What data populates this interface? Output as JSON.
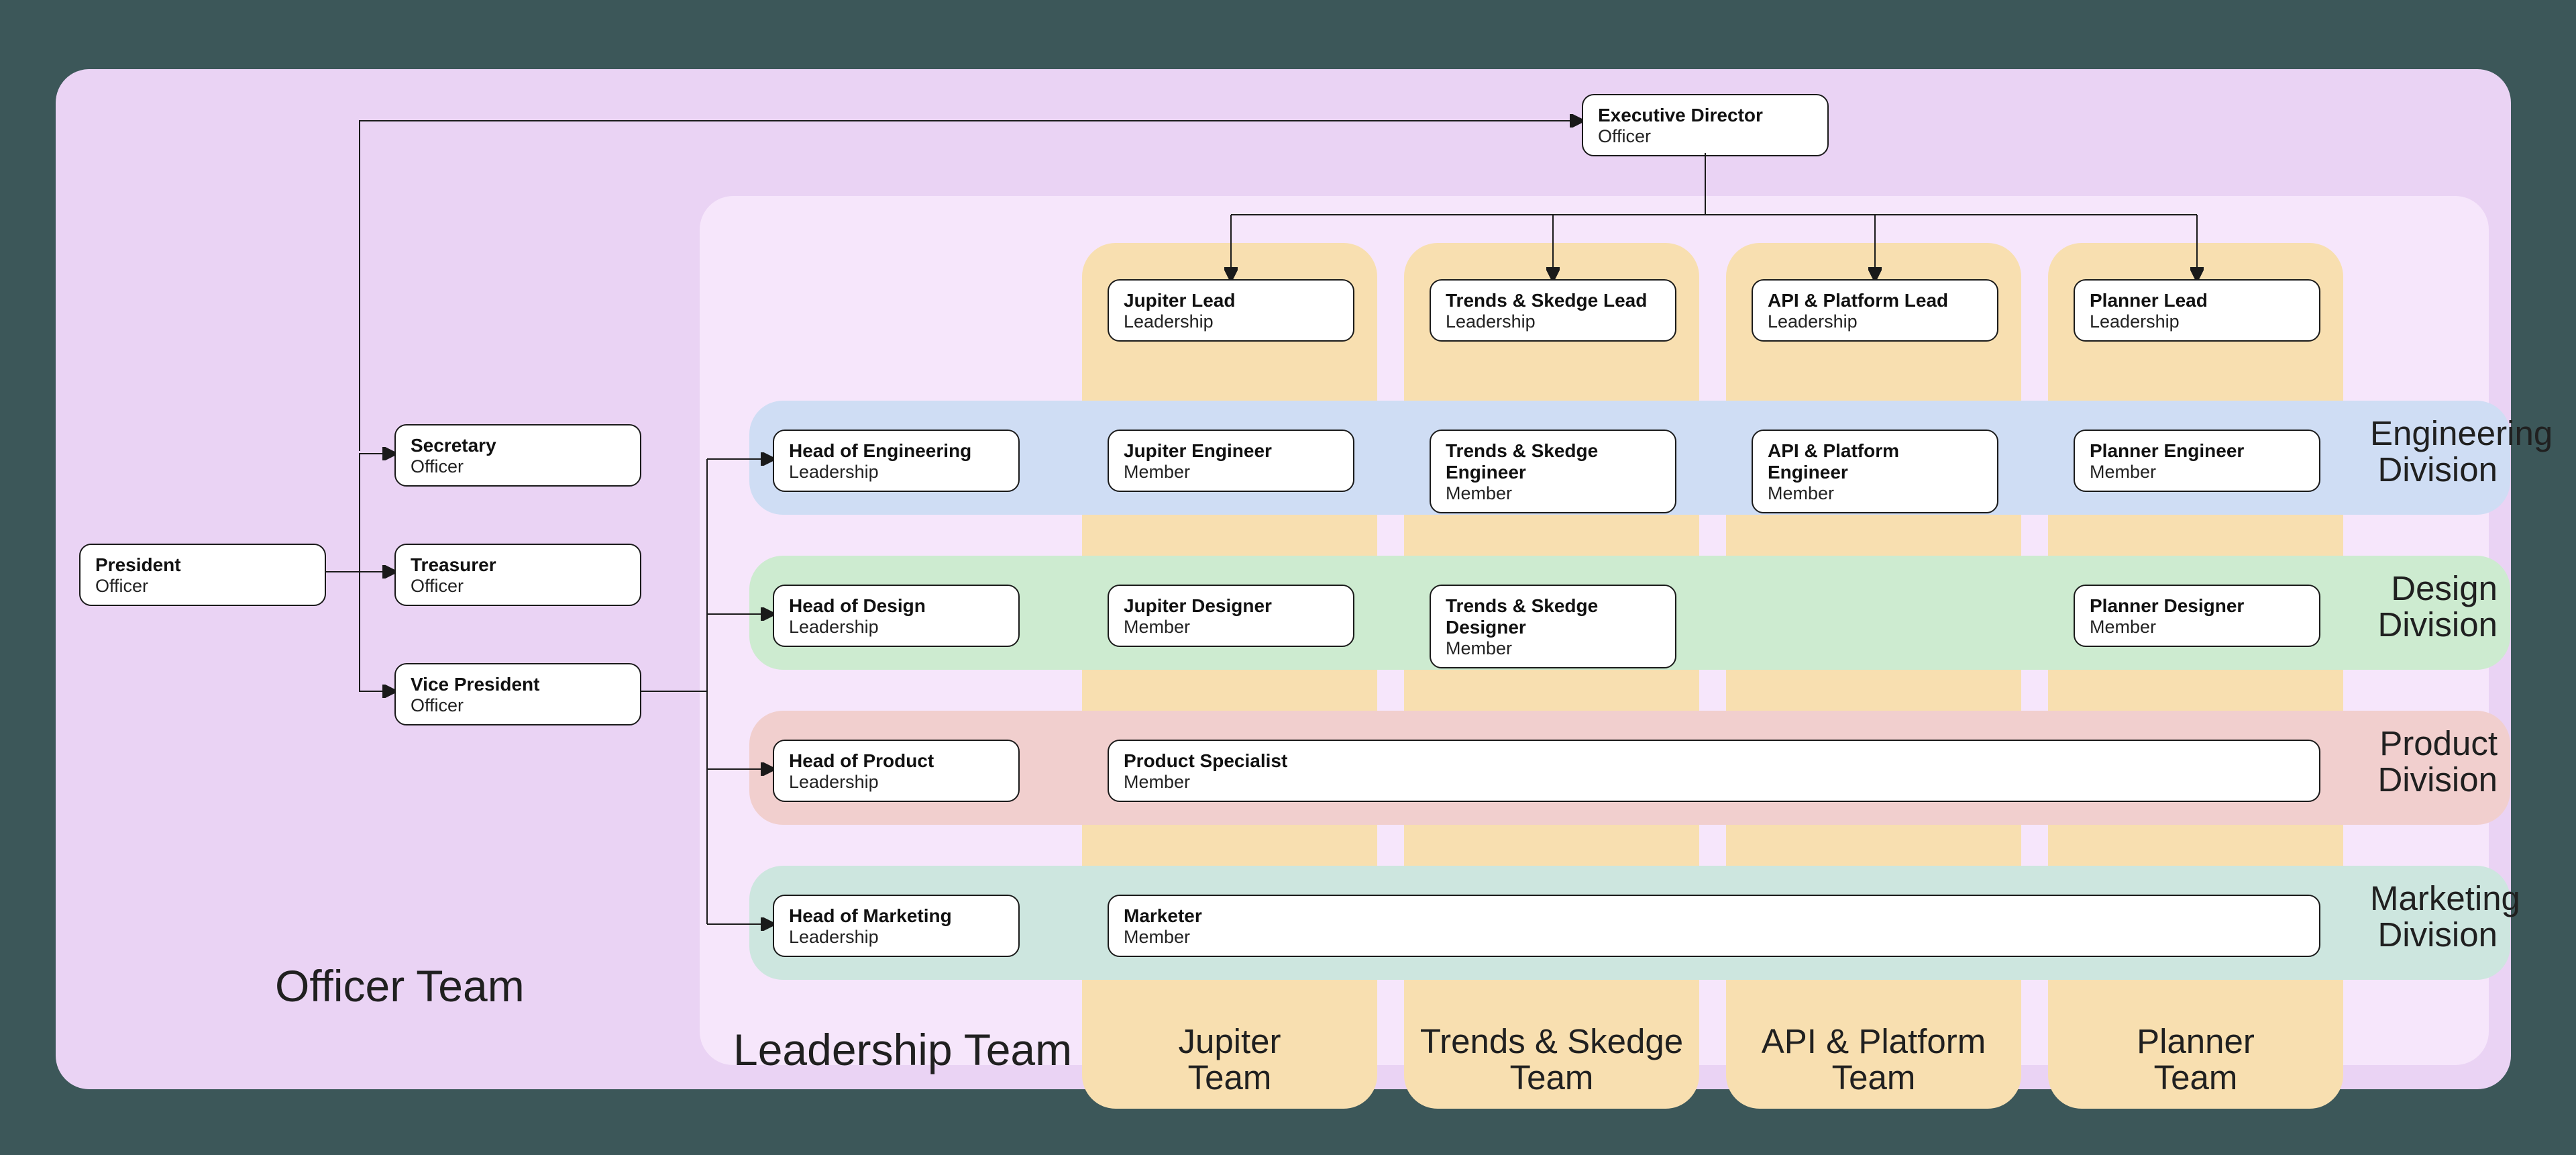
{
  "labels": {
    "officer_team": "Officer Team",
    "leadership_team": "Leadership Team",
    "engineering_division": "Engineering\nDivision",
    "design_division": "Design\nDivision",
    "product_division": "Product\nDivision",
    "marketing_division": "Marketing\nDivision",
    "jupiter_team": "Jupiter\nTeam",
    "trends_team": "Trends & Skedge\nTeam",
    "api_team": "API & Platform\nTeam",
    "planner_team": "Planner\nTeam"
  },
  "roles": {
    "president": {
      "title": "President",
      "sub": "Officer"
    },
    "secretary": {
      "title": "Secretary",
      "sub": "Officer"
    },
    "treasurer": {
      "title": "Treasurer",
      "sub": "Officer"
    },
    "vp": {
      "title": "Vice President",
      "sub": "Officer"
    },
    "exec_dir": {
      "title": "Executive Director",
      "sub": "Officer"
    },
    "jup_lead": {
      "title": "Jupiter Lead",
      "sub": "Leadership"
    },
    "trends_lead": {
      "title": "Trends & Skedge Lead",
      "sub": "Leadership"
    },
    "api_lead": {
      "title": "API & Platform Lead",
      "sub": "Leadership"
    },
    "plan_lead": {
      "title": "Planner Lead",
      "sub": "Leadership"
    },
    "head_eng": {
      "title": "Head of Engineering",
      "sub": "Leadership"
    },
    "head_des": {
      "title": "Head of Design",
      "sub": "Leadership"
    },
    "head_prod": {
      "title": "Head of Product",
      "sub": "Leadership"
    },
    "head_mkt": {
      "title": "Head of Marketing",
      "sub": "Leadership"
    },
    "jup_eng": {
      "title": "Jupiter Engineer",
      "sub": "Member"
    },
    "trends_eng": {
      "title": "Trends & Skedge Engineer",
      "sub": "Member"
    },
    "api_eng": {
      "title": "API & Platform Engineer",
      "sub": "Member"
    },
    "plan_eng": {
      "title": "Planner Engineer",
      "sub": "Member"
    },
    "jup_des": {
      "title": "Jupiter Designer",
      "sub": "Member"
    },
    "trends_des": {
      "title": "Trends & Skedge Designer",
      "sub": "Member"
    },
    "plan_des": {
      "title": "Planner Designer",
      "sub": "Member"
    },
    "prod_spec": {
      "title": "Product Specialist",
      "sub": "Member"
    },
    "marketer": {
      "title": "Marketer",
      "sub": "Member"
    }
  },
  "colors": {
    "bg": "#3c5759",
    "officer": "#ead3f4",
    "leadership": "#f6e6fb",
    "engineering": "#cfddf4",
    "design": "#cdebd0",
    "product": "#f1cfce",
    "marketing": "#cde6df",
    "team": "#f8dfb0",
    "card_border": "#1a1a1a"
  }
}
